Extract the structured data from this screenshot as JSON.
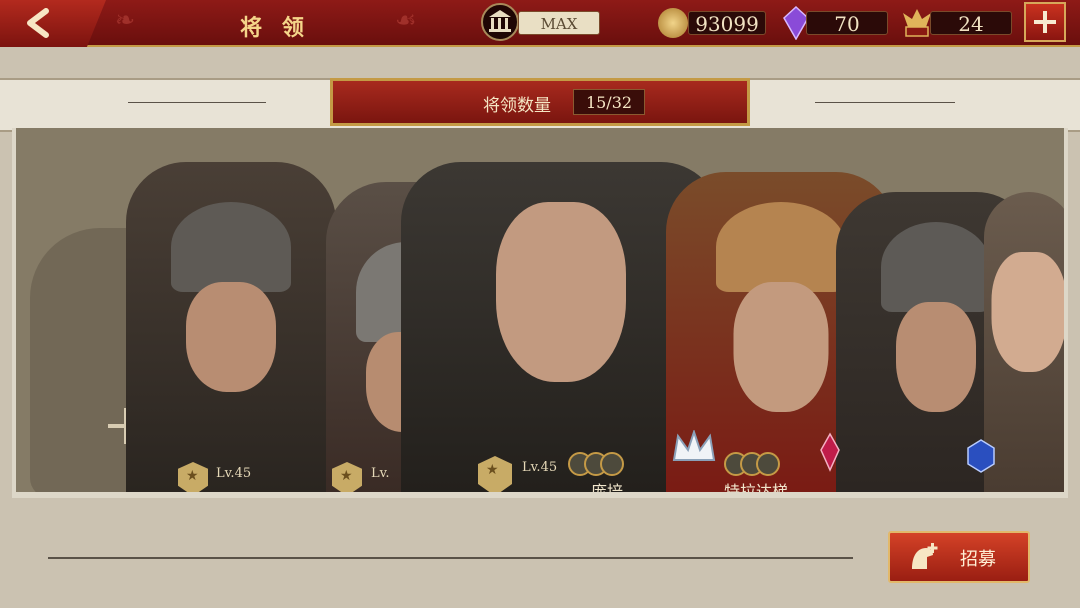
{
  "header": {
    "title": "将 领",
    "resources": {
      "building_level": "MAX",
      "gold": "93099",
      "gems": "70",
      "spqr_tokens": "24"
    },
    "icons": {
      "building": "temple-icon",
      "gold": "gold-coin-icon",
      "gems": "purple-crystal-icon",
      "spqr": "spqr-eagle-icon"
    }
  },
  "general_count": {
    "label": "将领数量",
    "value": "15/32"
  },
  "generals": [
    {
      "name": "",
      "level": "Lv.45"
    },
    {
      "name": "",
      "level": "Lv."
    },
    {
      "name": "庞培",
      "level": "Lv.45"
    },
    {
      "name": "特拉达梯",
      "level": ""
    },
    {
      "name": "",
      "level": ""
    },
    {
      "name": "",
      "level": ""
    }
  ],
  "recruit_button": {
    "label": "招募"
  },
  "colors": {
    "header_red": "#7c130f",
    "gold_trim": "#c49a45",
    "panel_bg": "#857b66"
  }
}
